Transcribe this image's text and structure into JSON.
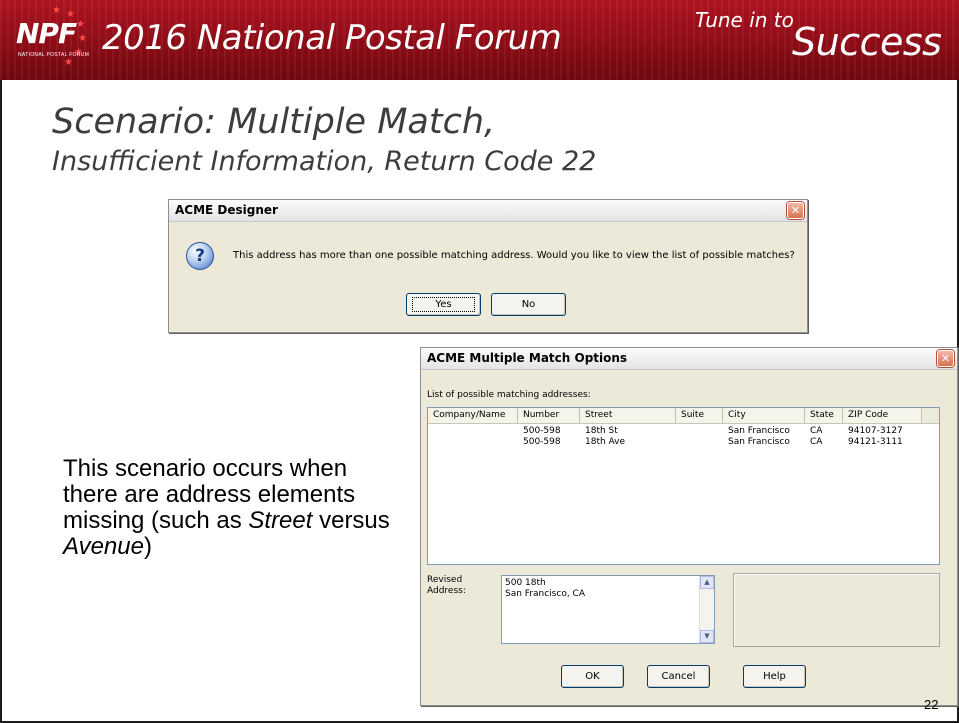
{
  "header": {
    "logo_text": "NPF",
    "logo_subtext": "NATIONAL POSTAL FORUM",
    "event_title": "2016 National Postal Forum",
    "tagline_small": "Tune in to",
    "tagline_large": "Success"
  },
  "slide": {
    "title_line1": "Scenario: Multiple Match,",
    "title_line2": "Insufficient Information, Return Code 22",
    "body_part1": "This scenario occurs when there are address elements missing (such as ",
    "body_street": "Street",
    "body_versus": " versus ",
    "body_avenue": "Avenue",
    "body_end": ")",
    "page_number": "22"
  },
  "designer_dialog": {
    "title": "ACME Designer",
    "close_glyph": "✕",
    "icon": "question-icon",
    "icon_glyph": "?",
    "message": "This address has more than one possible matching address.  Would you like to view the list of possible matches?",
    "yes_label": "Yes",
    "no_label": "No"
  },
  "match_dialog": {
    "title": "ACME Multiple Match Options",
    "close_glyph": "✕",
    "list_label": "List of possible matching addresses:",
    "columns": [
      "Company/Name",
      "Number",
      "Street",
      "Suite",
      "City",
      "State",
      "ZIP Code"
    ],
    "rows": [
      {
        "company": "",
        "number": "500-598",
        "street": "18th St",
        "suite": "",
        "city": "San Francisco",
        "state": "CA",
        "zip": "94107-3127"
      },
      {
        "company": "",
        "number": "500-598",
        "street": "18th Ave",
        "suite": "",
        "city": "San Francisco",
        "state": "CA",
        "zip": "94121-3111"
      }
    ],
    "revised_label_line1": "Revised",
    "revised_label_line2": "Address:",
    "revised_line1": "500 18th",
    "revised_line2": "San Francisco, CA",
    "scroll_up_glyph": "▲",
    "scroll_down_glyph": "▼",
    "ok_label": "OK",
    "cancel_label": "Cancel",
    "help_label": "Help"
  },
  "colors": {
    "banner_red": "#ae1320",
    "title_gray": "#3d3d3d",
    "dialog_face": "#ece9d8"
  }
}
